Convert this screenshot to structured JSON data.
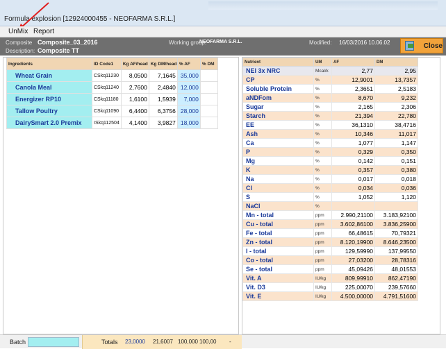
{
  "window": {
    "title": "Formula explosion  [12924000455 - NEOFARMA S.R.L.]"
  },
  "menu": {
    "items": [
      "UnMix",
      "Report"
    ]
  },
  "header": {
    "composite_label": "Composite",
    "composite_value": "Composite_03_2016",
    "description_label": "Description:",
    "description_value": "Composite TT",
    "working_group_label": "Working group:",
    "working_group_value": "NEOFARMA S.R.L.",
    "modified_label": "Modified:",
    "modified_value": "16/03/2016 10.06.02",
    "close_label": "Close"
  },
  "ingredients": {
    "columns": [
      "Ingredients",
      "ID Code1",
      "Kg AF/head",
      "Kg DM/head",
      "% AF",
      "% DM"
    ],
    "rows": [
      {
        "name": "Wheat Grain",
        "code": "CSkq11230",
        "kg_af": "8,0500",
        "kg_dm": "7,1645",
        "pct_af": "35,000",
        "pct_dm": ""
      },
      {
        "name": "Canola Meal",
        "code": "CSkq11240",
        "kg_af": "2,7600",
        "kg_dm": "2,4840",
        "pct_af": "12,000",
        "pct_dm": ""
      },
      {
        "name": "Energizer RP10",
        "code": "CSkq11180",
        "kg_af": "1,6100",
        "kg_dm": "1,5939",
        "pct_af": "7,000",
        "pct_dm": ""
      },
      {
        "name": "Tallow Poultry",
        "code": "CSkq11090",
        "kg_af": "6,4400",
        "kg_dm": "6,3756",
        "pct_af": "28,000",
        "pct_dm": ""
      },
      {
        "name": "DairySmart 2.0 Premix",
        "code": "ISkq112504",
        "kg_af": "4,1400",
        "kg_dm": "3,9827",
        "pct_af": "18,000",
        "pct_dm": ""
      }
    ]
  },
  "nutrients": {
    "columns": [
      "Nutrient",
      "UM",
      "AF",
      "DM"
    ],
    "rows": [
      {
        "name": "NEl 3x NRC",
        "um": "Mcal/k",
        "af": "2,77",
        "dm": "2,95"
      },
      {
        "name": "CP",
        "um": "%",
        "af": "12,9001",
        "dm": "13,7357"
      },
      {
        "name": "Soluble Protein",
        "um": "%",
        "af": "2,3651",
        "dm": "2,5183"
      },
      {
        "name": "aNDFom",
        "um": "%",
        "af": "8,670",
        "dm": "9,232"
      },
      {
        "name": "Sugar",
        "um": "%",
        "af": "2,165",
        "dm": "2,306"
      },
      {
        "name": "Starch",
        "um": "%",
        "af": "21,394",
        "dm": "22,780"
      },
      {
        "name": "EE",
        "um": "%",
        "af": "36,1310",
        "dm": "38,4716"
      },
      {
        "name": "Ash",
        "um": "%",
        "af": "10,346",
        "dm": "11,017"
      },
      {
        "name": "Ca",
        "um": "%",
        "af": "1,077",
        "dm": "1,147"
      },
      {
        "name": "P",
        "um": "%",
        "af": "0,329",
        "dm": "0,350"
      },
      {
        "name": "Mg",
        "um": "%",
        "af": "0,142",
        "dm": "0,151"
      },
      {
        "name": "K",
        "um": "%",
        "af": "0,357",
        "dm": "0,380"
      },
      {
        "name": "Na",
        "um": "%",
        "af": "0,017",
        "dm": "0,018"
      },
      {
        "name": "Cl",
        "um": "%",
        "af": "0,034",
        "dm": "0,036"
      },
      {
        "name": "S",
        "um": "%",
        "af": "1,052",
        "dm": "1,120"
      },
      {
        "name": "NaCl",
        "um": "%",
        "af": "",
        "dm": ""
      },
      {
        "name": "Mn - total",
        "um": "ppm",
        "af": "2.990,21100",
        "dm": "3.183,92100"
      },
      {
        "name": "Cu - total",
        "um": "ppm",
        "af": "3.602,86100",
        "dm": "3.836,25900"
      },
      {
        "name": "Fe - total",
        "um": "ppm",
        "af": "66,48615",
        "dm": "70,79321"
      },
      {
        "name": "Zn - total",
        "um": "ppm",
        "af": "8.120,19900",
        "dm": "8.646,23500"
      },
      {
        "name": "I - total",
        "um": "ppm",
        "af": "129,59990",
        "dm": "137,99550"
      },
      {
        "name": "Co - total",
        "um": "ppm",
        "af": "27,03200",
        "dm": "28,78316"
      },
      {
        "name": "Se - total",
        "um": "ppm",
        "af": "45,09426",
        "dm": "48,01553"
      },
      {
        "name": "Vit. A",
        "um": "IU/kg",
        "af": "809,99910",
        "dm": "862,47190"
      },
      {
        "name": "Vit. D3",
        "um": "IU/kg",
        "af": "225,00070",
        "dm": "239,57660"
      },
      {
        "name": "Vit. E",
        "um": "IU/kg",
        "af": "4.500,00000",
        "dm": "4.791,51600"
      }
    ]
  },
  "footer": {
    "batch_label": "Batch",
    "batch_value": "",
    "totals_label": "Totals",
    "total_kg_af": "23,0000",
    "total_kg_dm": "21,6007",
    "total_pct_af": "100,000",
    "total_pct_dm": "100,00",
    "dash": "-"
  }
}
